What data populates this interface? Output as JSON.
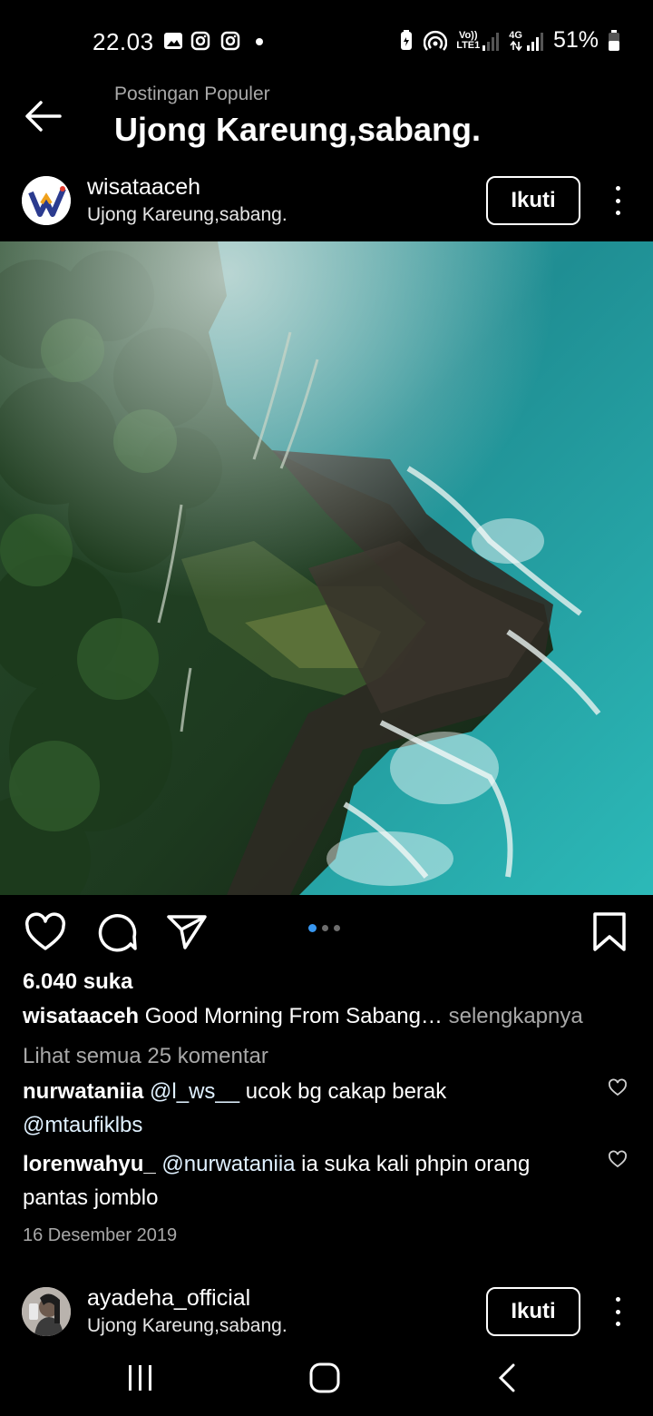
{
  "status_bar": {
    "time": "22.03",
    "network_label_1_top": "Vo))",
    "network_label_1_bottom": "LTE1",
    "network_label_2_top": "4G",
    "battery": "51%"
  },
  "header": {
    "subtitle": "Postingan Populer",
    "title": "Ujong Kareung,sabang."
  },
  "post": {
    "username": "wisataaceh",
    "location": "Ujong Kareung,sabang.",
    "follow_label": "Ikuti",
    "likes": "6.040 suka",
    "caption_user": "wisataaceh",
    "caption_text": "Good Morning From Sabang…",
    "caption_more": "selengkapnya",
    "view_all": "Lihat semua 25 komentar",
    "comments": [
      {
        "user": "nurwataniia",
        "mention": "@l_ws__",
        "text": "ucok bg cakap berak",
        "text2": "@mtaufiklbs"
      },
      {
        "user": "lorenwahyu_",
        "mention": "@nurwataniia",
        "text": "ia suka kali phpin orang",
        "text2": "pantas jomblo"
      }
    ],
    "date": "16 Desember 2019",
    "carousel_count": 3,
    "carousel_active": 0
  },
  "next_post": {
    "username": "ayadeha_official",
    "location": "Ujong Kareung,sabang.",
    "follow_label": "Ikuti"
  },
  "colors": {
    "background": "#000000",
    "muted_text": "#a8a8a8",
    "carousel_active": "#3897f0"
  }
}
